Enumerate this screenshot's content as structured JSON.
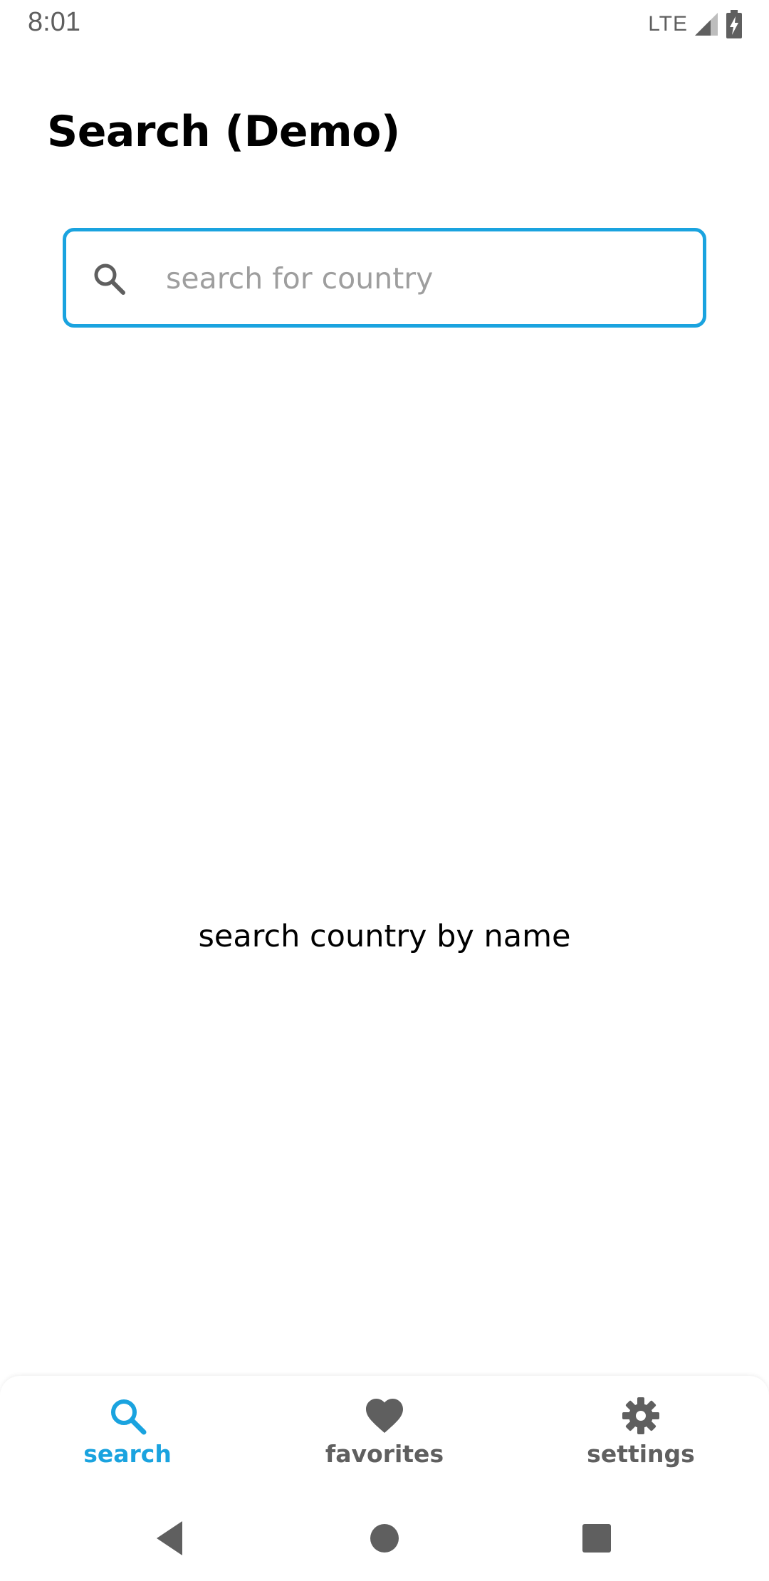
{
  "status_bar": {
    "time": "8:01",
    "network": "LTE"
  },
  "page": {
    "title": "Search (Demo)"
  },
  "search": {
    "placeholder": "search for country",
    "value": "",
    "icon": "search-icon"
  },
  "empty_state": {
    "message": "search country by name"
  },
  "bottom_nav": {
    "items": [
      {
        "label": "search",
        "icon": "search-icon",
        "active": true
      },
      {
        "label": "favorites",
        "icon": "heart-icon",
        "active": false
      },
      {
        "label": "settings",
        "icon": "gear-icon",
        "active": false
      }
    ]
  },
  "colors": {
    "accent": "#1aa3df",
    "inactive": "#5f5f5f",
    "text": "#000000",
    "placeholder": "#9e9e9e"
  }
}
